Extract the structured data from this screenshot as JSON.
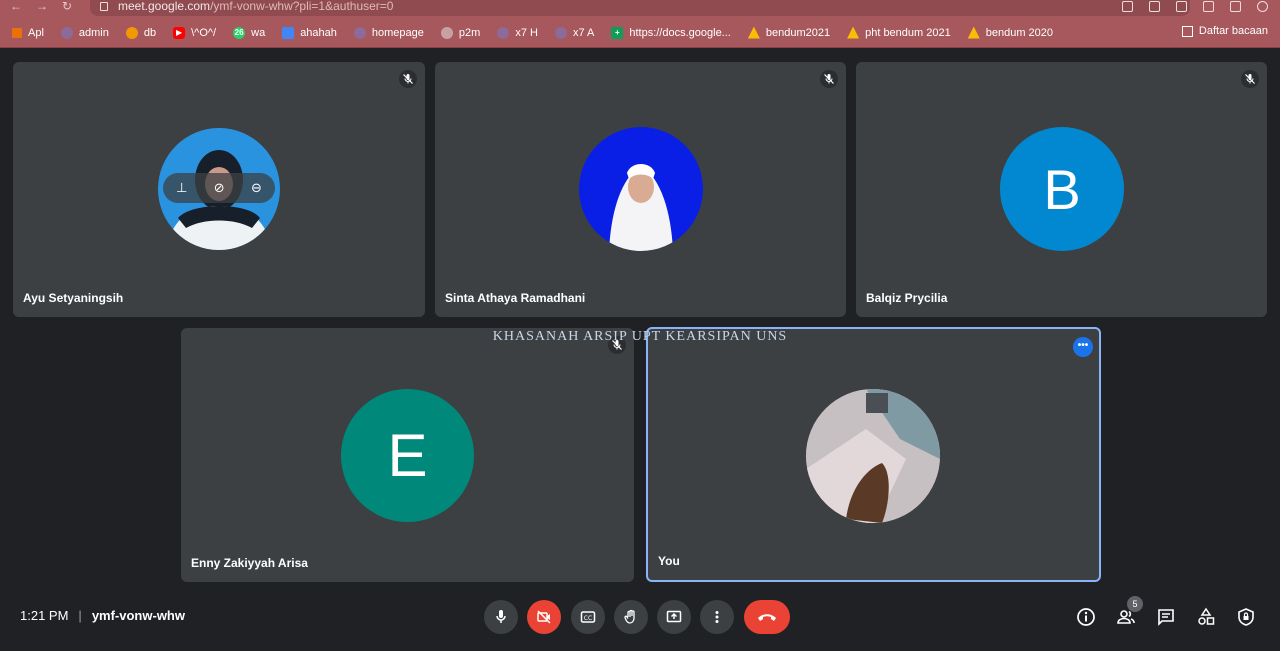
{
  "browser": {
    "url": "meet.google.com",
    "url_path": "/ymf-vonw-whw?pli=1&authuser=0",
    "bookmarks": [
      "Apl",
      "admin",
      "db",
      "\\^O^/",
      "wa",
      "ahahah",
      "homepage",
      "p2m",
      "x7 H",
      "x7 A",
      "https://docs.google...",
      "bendum2021",
      "pht bendum 2021",
      "bendum 2020"
    ],
    "wa_badge": "26",
    "reading_list": "Daftar bacaan"
  },
  "participants": [
    {
      "name": "Ayu Setyaningsih",
      "type": "photo"
    },
    {
      "name": "Sinta Athaya Ramadhani",
      "type": "photo"
    },
    {
      "name": "Balqiz Prycilia",
      "type": "letter",
      "letter": "B",
      "color": "#0288d1"
    },
    {
      "name": "Enny Zakiyyah Arisa",
      "type": "letter",
      "letter": "E",
      "color": "#00897b"
    },
    {
      "name": "You",
      "type": "photo"
    }
  ],
  "watermark": "KHASANAH ARSIP UPT KEARSIPAN UNS",
  "meeting": {
    "time": "1:21 PM",
    "code": "ymf-vonw-whw",
    "people_count": "5"
  },
  "colors": {
    "accent": "#1a73e8",
    "danger": "#ea4335",
    "tile": "#3c4043",
    "background": "#202124"
  }
}
